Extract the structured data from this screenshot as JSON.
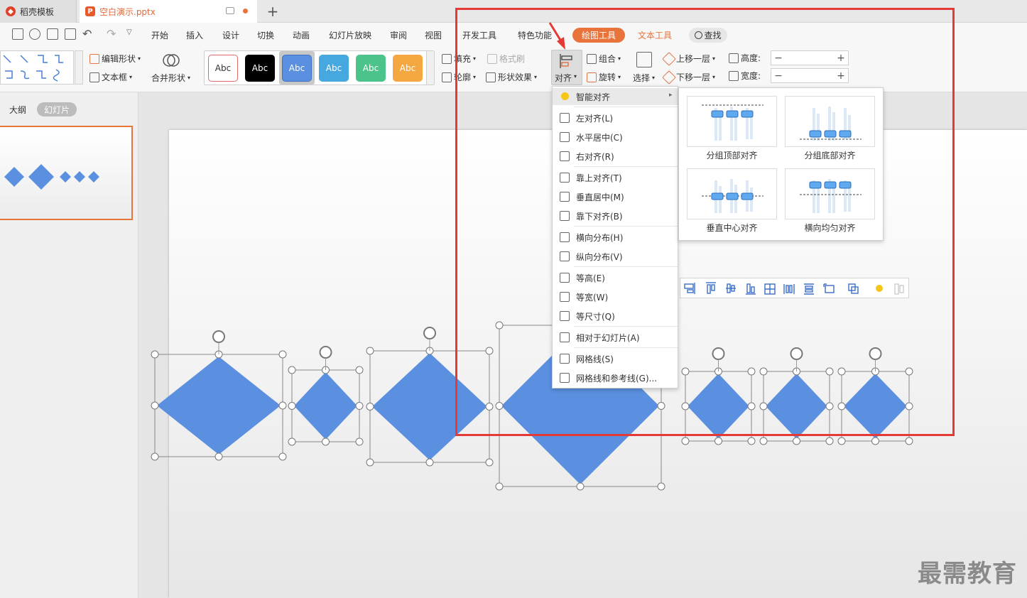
{
  "tabs": {
    "tab1": "稻壳模板",
    "tab2": "空白演示.pptx",
    "new": "+"
  },
  "menu": {
    "items": [
      "开始",
      "插入",
      "设计",
      "切换",
      "动画",
      "幻灯片放映",
      "审阅",
      "视图",
      "开发工具",
      "特色功能",
      "绘图工具",
      "文本工具"
    ],
    "search": "查找"
  },
  "ribbon": {
    "edit_shape": "编辑形状",
    "text_box": "文本框",
    "merge_shape": "合并形状",
    "swatch_label": "Abc",
    "fill": "填充",
    "format_brush": "格式刷",
    "outline": "轮廓",
    "shape_effect": "形状效果",
    "align": "对齐",
    "group": "组合",
    "rotate": "旋转",
    "select": "选择",
    "bring_forward": "上移一层",
    "send_backward": "下移一层",
    "height": "高度:",
    "width": "宽度:",
    "minus": "−",
    "plus": "+"
  },
  "swatches": [
    {
      "bg": "#ffffff",
      "fg": "#333333",
      "border": "#e06a6a"
    },
    {
      "bg": "#000000",
      "fg": "#ffffff",
      "border": "#000000"
    },
    {
      "bg": "#5b8fdf",
      "fg": "#ffffff",
      "border": "#3e6fc0"
    },
    {
      "bg": "#47a8df",
      "fg": "#ffffff",
      "border": "#47a8df"
    },
    {
      "bg": "#4cc38a",
      "fg": "#ffffff",
      "border": "#4cc38a"
    },
    {
      "bg": "#f5a742",
      "fg": "#ffffff",
      "border": "#f5a742"
    }
  ],
  "left_panel": {
    "outline": "大纲",
    "slides": "幻灯片"
  },
  "align_menu": {
    "smart": "智能对齐",
    "rows": [
      "左对齐(L)",
      "水平居中(C)",
      "右对齐(R)",
      "靠上对齐(T)",
      "垂直居中(M)",
      "靠下对齐(B)",
      "横向分布(H)",
      "纵向分布(V)",
      "等高(E)",
      "等宽(W)",
      "等尺寸(Q)",
      "相对于幻灯片(A)",
      "网格线(S)",
      "网格线和参考线(G)..."
    ]
  },
  "smart_align": [
    "分组顶部对齐",
    "分组底部对齐",
    "垂直中心对齐",
    "横向均匀对齐"
  ],
  "watermark": "最需教育",
  "colors": {
    "accent": "#e8743b",
    "shape": "#5b8fdf",
    "highlight": "#e53935"
  }
}
